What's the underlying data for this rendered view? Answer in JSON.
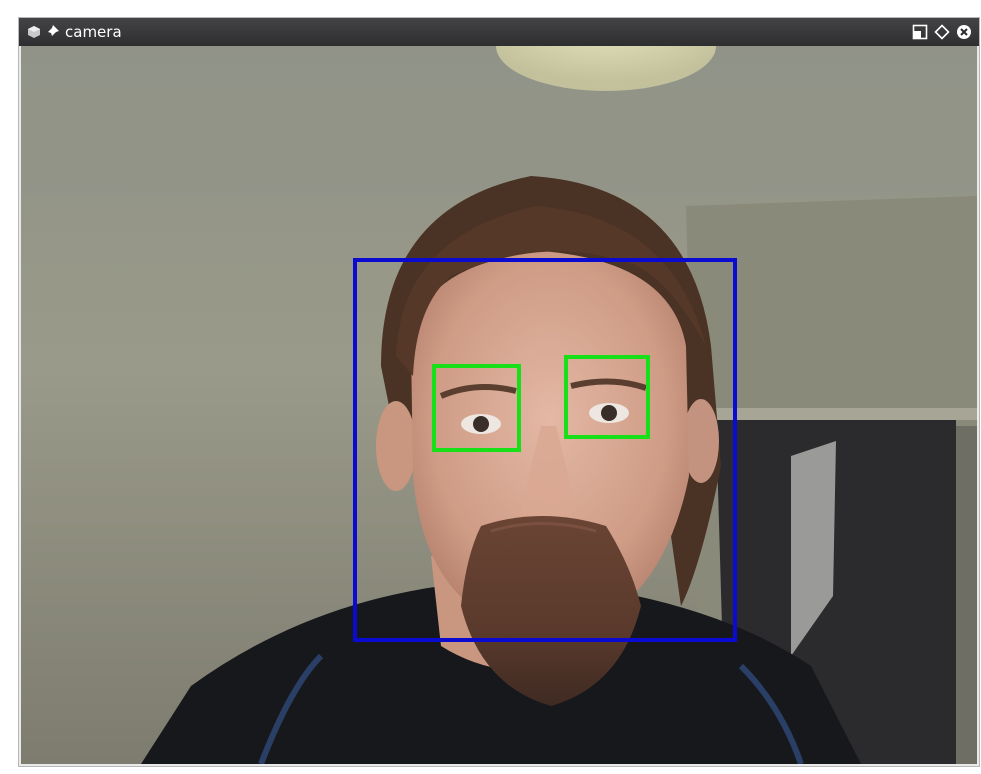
{
  "window": {
    "title": "camera"
  },
  "icons": {
    "app": "window-menu-icon",
    "pin": "pin-icon",
    "restore": "restore-icon",
    "maximize": "maximize-icon",
    "close": "close-icon"
  },
  "colors": {
    "face_box": "#0a0ad0",
    "eye_box": "#18e018",
    "titlebar": "#3a3a3c"
  }
}
